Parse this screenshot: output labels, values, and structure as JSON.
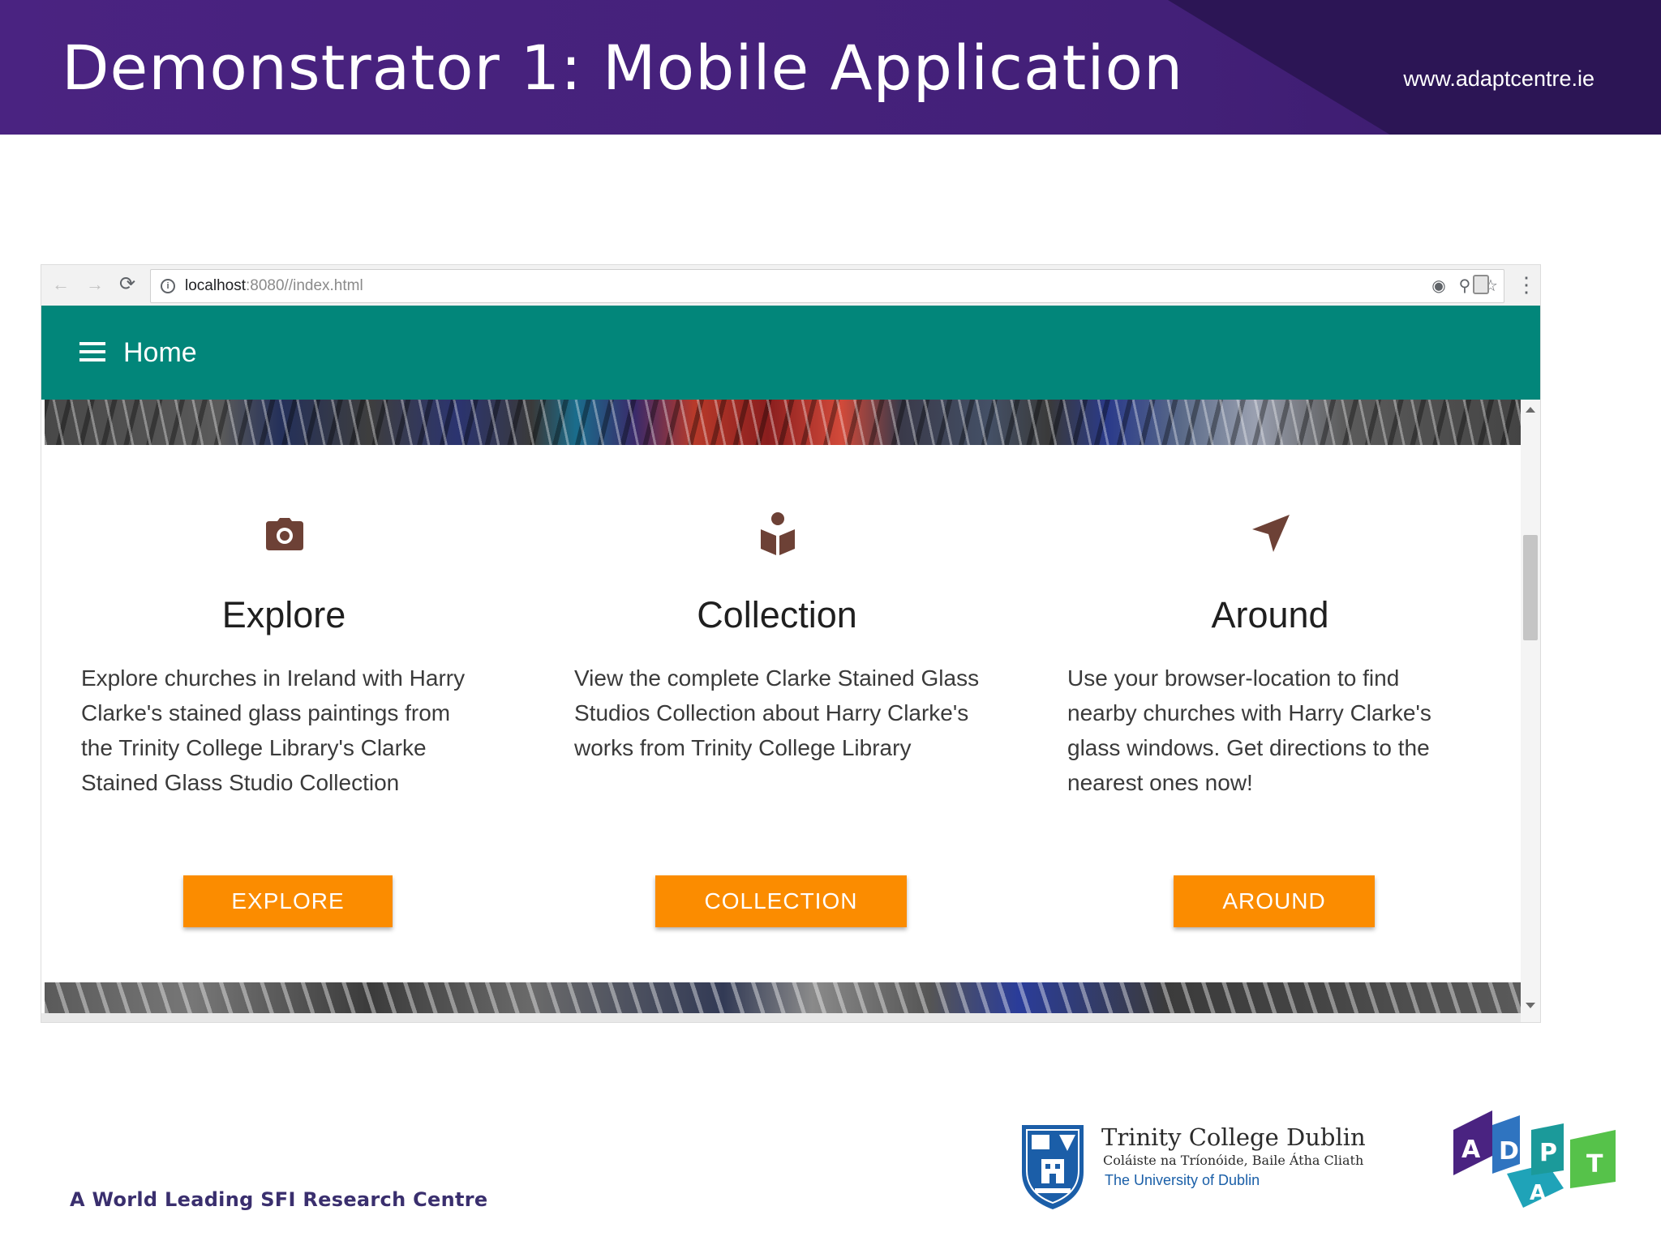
{
  "slide": {
    "title": "Demonstrator 1: Mobile Application",
    "url": "www.adaptcentre.ie",
    "tagline": "A World Leading SFI Research Centre"
  },
  "browser": {
    "address": {
      "host": "localhost",
      "path": ":8080//index.html"
    },
    "nav": {
      "back": "←",
      "forward": "→",
      "reload": "⟳"
    },
    "address_icons": [
      "◉",
      "⚲",
      "☆"
    ],
    "menu": "⋮"
  },
  "app": {
    "title": "Home",
    "theme_color": "#02867a",
    "accent_color": "#fb8c00",
    "icon_color": "#6d4136",
    "features": [
      {
        "icon": "camera-icon",
        "heading": "Explore",
        "description": "Explore churches in Ireland with Harry Clarke's stained glass paintings from the Trinity College Library's Clarke Stained Glass Studio Collection",
        "button": "EXPLORE"
      },
      {
        "icon": "book-reader-icon",
        "heading": "Collection",
        "description": "View the complete Clarke Stained Glass Studios Collection about Harry Clarke's works from Trinity College Library",
        "button": "COLLECTION"
      },
      {
        "icon": "navigation-arrow-icon",
        "heading": "Around",
        "description": "Use your browser-location to find nearby churches with Harry Clarke's glass windows. Get directions to the nearest ones now!",
        "button": "AROUND"
      }
    ]
  },
  "logos": {
    "tcd": {
      "name": "Trinity College Dublin",
      "irish": "Coláiste na Tríonóide, Baile Átha Cliath",
      "subtitle": "The University of Dublin"
    },
    "adapt": {
      "letters": [
        "A",
        "D",
        "A",
        "P",
        "T"
      ]
    }
  }
}
